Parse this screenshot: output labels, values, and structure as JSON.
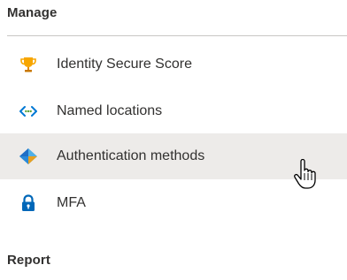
{
  "sections": {
    "manage": {
      "title": "Manage",
      "items": [
        {
          "label": "Identity Secure Score",
          "icon": "trophy-icon",
          "selected": false
        },
        {
          "label": "Named locations",
          "icon": "code-arrows-icon",
          "selected": false
        },
        {
          "label": "Authentication methods",
          "icon": "diamond-icon",
          "selected": true
        },
        {
          "label": "MFA",
          "icon": "lock-icon",
          "selected": false
        }
      ]
    },
    "report": {
      "title": "Report"
    }
  },
  "colors": {
    "selected_bg": "#edebe9",
    "text": "#323130",
    "divider": "#c8c6c4",
    "trophy": "#f7a600",
    "link_blue": "#0078d4",
    "lock_blue": "#0067b8"
  },
  "cursor": "hand-pointer-icon"
}
